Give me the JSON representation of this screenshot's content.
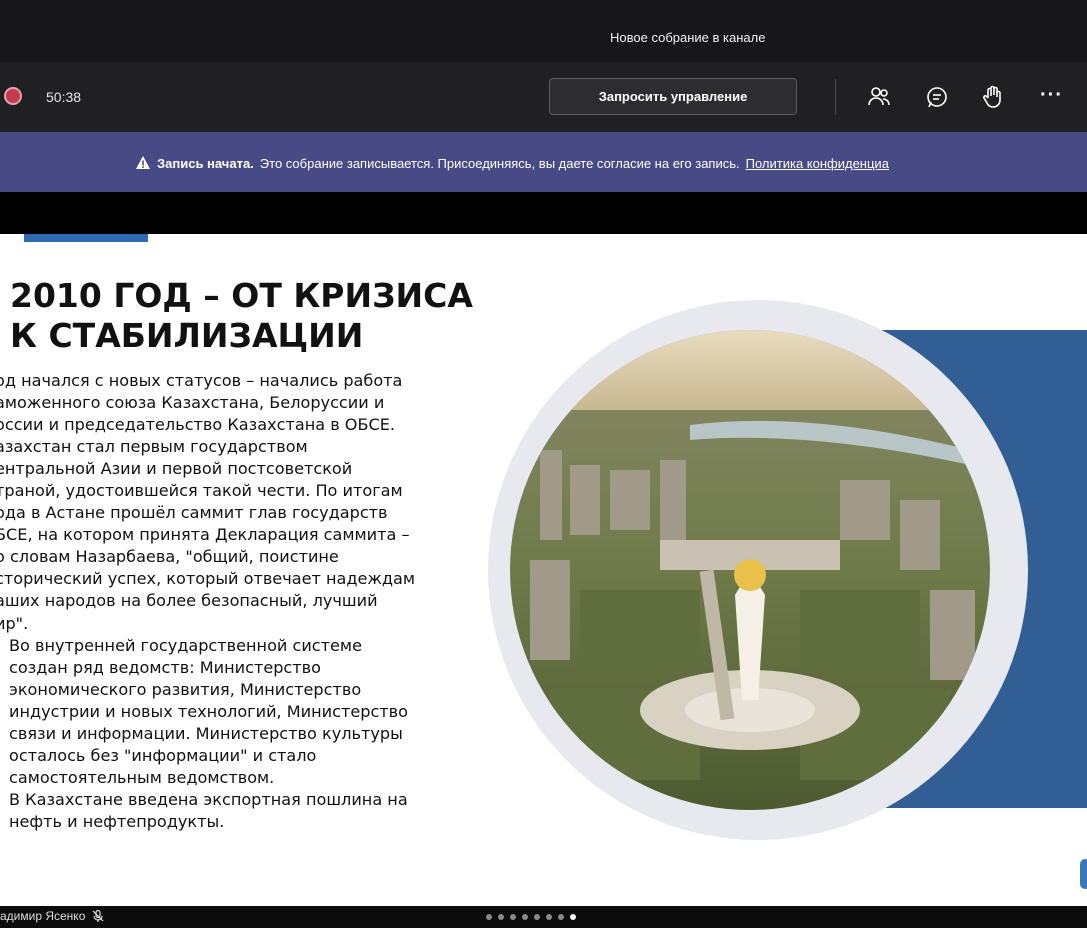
{
  "window": {
    "title": "Новое собрание в канале"
  },
  "toolbar": {
    "timer": "50:38",
    "request_control_label": "Запросить управление",
    "more_label": "···",
    "icons": [
      "people-icon",
      "chat-icon",
      "raise-hand-icon",
      "more-icon"
    ]
  },
  "banner": {
    "strong": "Запись начата.",
    "text": "Это собрание записывается. Присоединяясь, вы даете согласие на его запись.",
    "link": "Политика конфиденциа"
  },
  "slide": {
    "title": "2010 ГОД – ОТ КРИЗИСА К СТАБИЛИЗАЦИИ",
    "lines1": [
      "од начался с новых статусов – начались работа",
      "аможенного союза Казахстана, Белоруссии и",
      "оссии и председательство Казахстана в ОБСЕ.",
      "азахстан стал первым государством",
      "ентральной Азии и первой постсоветской",
      "траной, удостоившейся такой чести. По итогам",
      "ода в Астане прошёл саммит глав государств",
      "БСЕ, на котором принята Декларация саммита –",
      "о словам Назарбаева, \"общий, поистине",
      "сторический успех, который отвечает надеждам",
      "аших народов на более безопасный, лучший",
      "ир\"."
    ],
    "lines2": [
      "Во внутренней государственной системе",
      "создан ряд ведомств: Министерство",
      "экономического развития, Министерство",
      "индустрии и новых технологий, Министерство",
      "связи и информации. Министерство культуры",
      "осталось без \"информации\" и стало",
      "самостоятельным ведомством.",
      "В Казахстане введена экспортная пошлина на",
      "нефть и нефтепродукты."
    ],
    "image_alt": "Aerial view of Astana with Baiterek tower"
  },
  "bottom": {
    "presenter": "адимир Ясенко",
    "slide_dots": 8,
    "active_dot": 7
  },
  "colors": {
    "recording": "#c43c4b",
    "banner": "#484a86",
    "accent": "#2f6ab5",
    "panel": "#315f95"
  }
}
